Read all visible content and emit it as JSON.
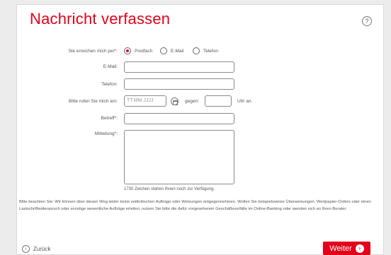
{
  "form": {
    "title": "Nachricht verfassen",
    "help_symbol": "?",
    "contact_label": "Sie erreichen mich per*:",
    "contact_options": [
      "Postfach",
      "E-Mail",
      "Telefon"
    ],
    "contact_selected": "Postfach",
    "email_label": "E-Mail:",
    "phone_label": "Telefon:",
    "callback_label": "Bitte rufen Sie mich am:",
    "date_placeholder": "TT.MM.JJJJ",
    "time_label": "gegen:",
    "time_suffix": "Uhr an.",
    "subject_label": "Betreff*:",
    "message_label": "Mitteilung*:",
    "char_counter": "1730 Zeichen stehen Ihnen noch zur Verfügung.",
    "notice": "Bitte beachten Sie: Wir können über diesen Weg leider keine zeitkritischen Aufträge oder Weisungen entgegennehmen. Wollen Sie beispielsweise Überweisungen, Wertpapier-Orders oder einen Lastschriftwiderspruch oder sonstige wesentliche Aufträge erteilen, nutzen Sie bitte die dafür vorgesehenen Geschäftsvorfälle im Online-Banking oder wenden sich an Ihren Berater."
  },
  "footer": {
    "back_label": "Zurück",
    "next_label": "Weiter"
  },
  "colors": {
    "accent": "#e2001a",
    "background": "#ececec"
  },
  "icons": {
    "help": "question-circle-icon",
    "calendar": "calendar-icon",
    "back": "chevron-left-circle-icon",
    "next": "chevron-right-circle-icon"
  }
}
